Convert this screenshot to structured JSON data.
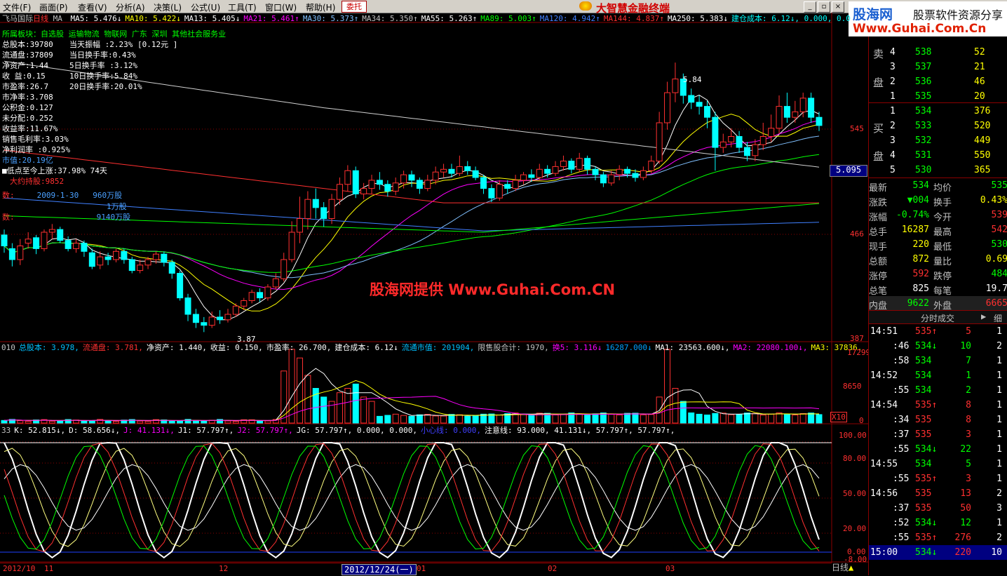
{
  "menu": [
    "文件(F)",
    "画面(P)",
    "查看(V)",
    "分析(A)",
    "决策(L)",
    "公式(U)",
    "工具(T)",
    "窗口(W)",
    "帮助(H)"
  ],
  "entrust_label": "委托",
  "app_title": "大智慧金融终端",
  "banner": {
    "brand": "股海网",
    "slogan": "股票软件资源分享",
    "url": "Www.Guhai.Com.Cn"
  },
  "chart_header": {
    "stock": "飞马国际",
    "period": "日线",
    "ma_label": "MA",
    "ma_items": [
      {
        "text": "MA5: 5.476↓",
        "color": "#ffffff"
      },
      {
        "text": "MA10: 5.422↓",
        "color": "#ffff00"
      },
      {
        "text": "MA13: 5.405↓",
        "color": "#ffffff"
      },
      {
        "text": "MA21: 5.461↑",
        "color": "#ff00ff"
      },
      {
        "text": "MA30: 5.373↑",
        "color": "#80c0ff"
      },
      {
        "text": "MA34: 5.350↑",
        "color": "#c0c0c0"
      },
      {
        "text": "MA55: 5.263↑",
        "color": "#ffffff"
      },
      {
        "text": "MA89: 5.003↑",
        "color": "#00ff00"
      },
      {
        "text": "MA120: 4.942↑",
        "color": "#4080ff"
      },
      {
        "text": "MA144: 4.837↑",
        "color": "#ff3030"
      },
      {
        "text": "MA250: 5.383↓",
        "color": "#ffffff"
      },
      {
        "text": "建仓成本: 6.12↓, 0.000, 0.0",
        "color": "#00ffff"
      }
    ]
  },
  "f10": {
    "industry": "所属板块：自选股 运输物流 物联网 广东 深圳 其他社会服务业",
    "rows_left": [
      "总股本:39780",
      "流通盘:37809",
      "净资产:1.44",
      "收  益:0.15",
      "市盈率:26.7",
      "市净率:3.708",
      "公积金:0.127",
      "未分配:0.252",
      "收益率:11.67%",
      "销售毛利率:3.03%",
      "净利润率 :0.925%"
    ],
    "rows_right": [
      "当天振幅  :2.23% [0.12元 ]",
      "当日换手率:0.43%",
      "5日换手率 :3.12%",
      "10日换手率:5.84%",
      "20日换手率:20.01%"
    ],
    "market_value": "市值:20.19亿",
    "low_gain": "■低点至今上涨:37.98%  74天",
    "holder_label": "大约持股:9852",
    "holder_line1_label": "数:",
    "holder_line1_date": "2009-1-30",
    "holder_line1_value": "960万股",
    "holder_line2_value": "1万股",
    "holder_line3_prefix": "数:",
    "holder_line3_value": "9140万股"
  },
  "price_axis": {
    "labels": [
      "545",
      "5.095",
      "466",
      "387"
    ],
    "current": "5.095"
  },
  "peak_label": "5.84",
  "low_label": "3.87",
  "watermark": "股海网提供 Www.Guhai.Com.CN",
  "vol_header": [
    {
      "text": "010",
      "color": "#c0c0c0"
    },
    {
      "text": "总股本: 3.978,",
      "color": "#00c0ff"
    },
    {
      "text": "流通盘: 3.781,",
      "color": "#ff3030"
    },
    {
      "text": "净资产: 1.440,",
      "color": "#ffffff"
    },
    {
      "text": "收益: 0.150,",
      "color": "#ffffff"
    },
    {
      "text": "市盈率: 26.700,",
      "color": "#ffffff"
    },
    {
      "text": "建仓成本: 6.12↓",
      "color": "#ffffff"
    },
    {
      "text": "流通市值: 201904,",
      "color": "#00c0ff"
    },
    {
      "text": "限售股合计: 1970,",
      "color": "#c0c0c0"
    },
    {
      "text": "换5: 3.116↓",
      "color": "#ff00ff"
    },
    {
      "text": "16287.000↓",
      "color": "#00a0ff"
    },
    {
      "text": "MA1: 23563.600↓,",
      "color": "#ffffff"
    },
    {
      "text": "MA2: 22080.100↓,",
      "color": "#ff00ff"
    },
    {
      "text": "MA3: 37836.",
      "color": "#ffff00"
    }
  ],
  "vol_axis": [
    "17299",
    "8650",
    "0"
  ],
  "vol_unit": "X10",
  "kdj_header": [
    {
      "text": "33",
      "color": "#c0c0c0"
    },
    {
      "text": "K: 52.815↓,",
      "color": "#ffffff"
    },
    {
      "text": "D: 58.656↓,",
      "color": "#ffffff"
    },
    {
      "text": "J: 41.131↓,",
      "color": "#ff00ff"
    },
    {
      "text": "J1: 57.797↑,",
      "color": "#ffffff"
    },
    {
      "text": "J2: 57.797↑,",
      "color": "#ff00ff"
    },
    {
      "text": "JG: 57.797↑, 0.000, 0.000,",
      "color": "#ffffff"
    },
    {
      "text": "小心线: 0.000,",
      "color": "#4040ff"
    },
    {
      "text": "注意线: 93.000, 41.131↓, 57.797↑, 57.797↑,",
      "color": "#ffffff"
    }
  ],
  "kdj_axis": [
    "100.00",
    "80.00",
    "50.00",
    "20.00",
    "0.00",
    "-8.00"
  ],
  "x_axis": {
    "labels": [
      "2012/10",
      "11",
      "12",
      "01",
      "02",
      "03"
    ],
    "cursor_date": "2012/12/24(一)"
  },
  "period_button": "日线",
  "quote": {
    "sell_label": [
      "卖",
      "盘"
    ],
    "buy_label": [
      "买",
      "盘"
    ],
    "sell": [
      {
        "lvl": "4",
        "price": "538",
        "vol": "52"
      },
      {
        "lvl": "3",
        "price": "537",
        "vol": "21"
      },
      {
        "lvl": "2",
        "price": "536",
        "vol": "46"
      },
      {
        "lvl": "1",
        "price": "535",
        "vol": "20"
      }
    ],
    "buy": [
      {
        "lvl": "1",
        "price": "534",
        "vol": "376"
      },
      {
        "lvl": "2",
        "price": "533",
        "vol": "520"
      },
      {
        "lvl": "3",
        "price": "532",
        "vol": "449"
      },
      {
        "lvl": "4",
        "price": "531",
        "vol": "550"
      },
      {
        "lvl": "5",
        "price": "530",
        "vol": "365"
      }
    ],
    "stats": [
      {
        "l1": "最新",
        "v1": "534",
        "c1": "#00ff00",
        "l2": "均价",
        "v2": "535",
        "c2": "#00ff00"
      },
      {
        "l1": "涨跌",
        "v1": "▼004",
        "c1": "#00ff00",
        "l2": "换手",
        "v2": "0.43%",
        "c2": "#ffff00"
      },
      {
        "l1": "涨幅",
        "v1": "-0.74%",
        "c1": "#00ff00",
        "l2": "今开",
        "v2": "539",
        "c2": "#ff3030"
      },
      {
        "l1": "总手",
        "v1": "16287",
        "c1": "#ffff00",
        "l2": "最高",
        "v2": "542",
        "c2": "#ff3030"
      },
      {
        "l1": "现手",
        "v1": "220",
        "c1": "#ffff00",
        "l2": "最低",
        "v2": "530",
        "c2": "#00ff00"
      },
      {
        "l1": "总额",
        "v1": "872",
        "c1": "#ffff00",
        "l2": "量比",
        "v2": "0.69",
        "c2": "#ffff00"
      },
      {
        "l1": "涨停",
        "v1": "592",
        "c1": "#ff3030",
        "l2": "跌停",
        "v2": "484",
        "c2": "#00ff00"
      },
      {
        "l1": "总笔",
        "v1": "825",
        "c1": "#ffffff",
        "l2": "每笔",
        "v2": "19.7",
        "c2": "#ffffff"
      },
      {
        "l1": "内盘",
        "v1": "9622",
        "c1": "#00ff00",
        "l2": "外盘",
        "v2": "6665",
        "c2": "#ff3030"
      }
    ],
    "ticks_title": "分时成交",
    "ticks_detail": "细",
    "ticks": [
      {
        "t": "14:51",
        "p": "535↑",
        "pc": "#ff3030",
        "v": "5",
        "vc": "#ff3030",
        "n": "1"
      },
      {
        "t": ":46",
        "p": "534↓",
        "pc": "#00ff00",
        "v": "10",
        "vc": "#00ff00",
        "n": "2"
      },
      {
        "t": ":58",
        "p": "534",
        "pc": "#00ff00",
        "v": "7",
        "vc": "#00ff00",
        "n": "1"
      },
      {
        "t": "14:52",
        "p": "534",
        "pc": "#00ff00",
        "v": "1",
        "vc": "#00ff00",
        "n": "1"
      },
      {
        "t": ":55",
        "p": "534",
        "pc": "#00ff00",
        "v": "2",
        "vc": "#00ff00",
        "n": "1"
      },
      {
        "t": "14:54",
        "p": "535↑",
        "pc": "#ff3030",
        "v": "8",
        "vc": "#ff3030",
        "n": "1"
      },
      {
        "t": ":34",
        "p": "535",
        "pc": "#ff3030",
        "v": "8",
        "vc": "#ff3030",
        "n": "1"
      },
      {
        "t": ":37",
        "p": "535",
        "pc": "#ff3030",
        "v": "3",
        "vc": "#ff3030",
        "n": "1"
      },
      {
        "t": ":55",
        "p": "534↓",
        "pc": "#00ff00",
        "v": "22",
        "vc": "#00ff00",
        "n": "1"
      },
      {
        "t": "14:55",
        "p": "534",
        "pc": "#00ff00",
        "v": "5",
        "vc": "#00ff00",
        "n": "1"
      },
      {
        "t": ":55",
        "p": "535↑",
        "pc": "#ff3030",
        "v": "3",
        "vc": "#ff3030",
        "n": "1"
      },
      {
        "t": "14:56",
        "p": "535",
        "pc": "#ff3030",
        "v": "13",
        "vc": "#ff3030",
        "n": "2"
      },
      {
        "t": ":37",
        "p": "535",
        "pc": "#ff3030",
        "v": "50",
        "vc": "#ff3030",
        "n": "3"
      },
      {
        "t": ":52",
        "p": "534↓",
        "pc": "#00ff00",
        "v": "12",
        "vc": "#00ff00",
        "n": "1"
      },
      {
        "t": ":55",
        "p": "535↑",
        "pc": "#ff3030",
        "v": "276",
        "vc": "#ff3030",
        "n": "2"
      },
      {
        "t": "15:00",
        "p": "534↓",
        "pc": "#00ff00",
        "v": "220",
        "vc": "#ff3030",
        "n": "10"
      }
    ]
  },
  "candles": [
    [
      4.58,
      4.5,
      4.62,
      4.45
    ],
    [
      4.48,
      4.4,
      4.52,
      4.35
    ],
    [
      4.4,
      4.5,
      4.55,
      4.36
    ],
    [
      4.52,
      4.55,
      4.6,
      4.48
    ],
    [
      4.56,
      4.48,
      4.58,
      4.44
    ],
    [
      4.48,
      4.6,
      4.62,
      4.46
    ],
    [
      4.6,
      4.62,
      4.66,
      4.55
    ],
    [
      4.62,
      4.54,
      4.64,
      4.52
    ],
    [
      4.54,
      4.48,
      4.57,
      4.46
    ],
    [
      4.48,
      4.52,
      4.55,
      4.45
    ],
    [
      4.52,
      4.46,
      4.54,
      4.42
    ],
    [
      4.45,
      4.35,
      4.48,
      4.33
    ],
    [
      4.36,
      4.42,
      4.46,
      4.33
    ],
    [
      4.42,
      4.4,
      4.45,
      4.36
    ],
    [
      4.4,
      4.46,
      4.48,
      4.38
    ],
    [
      4.46,
      4.4,
      4.48,
      4.37
    ],
    [
      4.4,
      4.32,
      4.42,
      4.3
    ],
    [
      4.32,
      4.36,
      4.4,
      4.3
    ],
    [
      4.36,
      4.4,
      4.42,
      4.33
    ],
    [
      4.4,
      4.44,
      4.46,
      4.37
    ],
    [
      4.44,
      4.38,
      4.46,
      4.35
    ],
    [
      4.38,
      4.3,
      4.4,
      4.26
    ],
    [
      4.3,
      4.12,
      4.32,
      4.1
    ],
    [
      4.12,
      4.0,
      4.15,
      3.95
    ],
    [
      4.0,
      3.94,
      4.04,
      3.9
    ],
    [
      3.94,
      3.92,
      3.98,
      3.87
    ],
    [
      3.92,
      3.98,
      4.02,
      3.9
    ],
    [
      3.98,
      3.96,
      4.03,
      3.93
    ],
    [
      3.96,
      4.0,
      4.04,
      3.94
    ],
    [
      4.0,
      4.06,
      4.08,
      3.98
    ],
    [
      4.06,
      4.1,
      4.12,
      4.03
    ],
    [
      4.1,
      4.16,
      4.18,
      4.08
    ],
    [
      4.16,
      4.12,
      4.19,
      4.09
    ],
    [
      4.12,
      4.2,
      4.22,
      4.1
    ],
    [
      4.2,
      4.26,
      4.3,
      4.18
    ],
    [
      4.26,
      4.4,
      4.45,
      4.24
    ],
    [
      4.4,
      4.6,
      4.68,
      4.38
    ],
    [
      4.6,
      4.7,
      4.86,
      4.52
    ],
    [
      4.7,
      4.84,
      4.9,
      4.62
    ],
    [
      4.84,
      4.78,
      4.92,
      4.7
    ],
    [
      4.78,
      4.7,
      4.82,
      4.64
    ],
    [
      4.7,
      4.84,
      4.88,
      4.66
    ],
    [
      4.84,
      4.95,
      5.0,
      4.8
    ],
    [
      4.95,
      5.05,
      5.09,
      4.9
    ],
    [
      5.05,
      4.88,
      5.08,
      4.85
    ],
    [
      4.88,
      4.92,
      4.96,
      4.84
    ],
    [
      4.92,
      4.98,
      5.02,
      4.88
    ],
    [
      4.98,
      4.95,
      5.04,
      4.91
    ],
    [
      4.95,
      4.9,
      4.98,
      4.86
    ],
    [
      4.9,
      4.96,
      5.0,
      4.87
    ],
    [
      4.96,
      5.02,
      5.05,
      4.92
    ],
    [
      5.02,
      4.98,
      5.05,
      4.93
    ],
    [
      4.98,
      4.92,
      5.0,
      4.88
    ],
    [
      4.92,
      4.98,
      5.02,
      4.9
    ],
    [
      4.98,
      5.04,
      5.08,
      4.95
    ],
    [
      5.04,
      5.06,
      5.1,
      5.0
    ],
    [
      5.06,
      5.03,
      5.1,
      5.0
    ],
    [
      5.03,
      5.08,
      5.16,
      5.01
    ],
    [
      5.08,
      5.05,
      5.12,
      5.02
    ],
    [
      5.05,
      5.0,
      5.08,
      4.98
    ],
    [
      5.0,
      4.92,
      5.02,
      4.88
    ],
    [
      4.92,
      4.85,
      4.95,
      4.82
    ],
    [
      4.85,
      4.95,
      4.98,
      4.83
    ],
    [
      4.95,
      4.92,
      4.98,
      4.88
    ],
    [
      4.92,
      4.98,
      5.02,
      4.9
    ],
    [
      4.98,
      5.02,
      5.04,
      4.95
    ],
    [
      5.02,
      5.0,
      5.06,
      4.97
    ],
    [
      5.0,
      5.06,
      5.1,
      4.98
    ],
    [
      5.06,
      5.03,
      5.09,
      5.0
    ],
    [
      5.03,
      5.08,
      5.12,
      5.01
    ],
    [
      5.08,
      5.12,
      5.16,
      5.05
    ],
    [
      5.12,
      5.06,
      5.14,
      5.03
    ],
    [
      5.06,
      5.14,
      5.18,
      5.04
    ],
    [
      5.14,
      5.06,
      5.16,
      5.02
    ],
    [
      5.06,
      5.02,
      5.08,
      4.98
    ],
    [
      5.02,
      4.96,
      5.04,
      4.93
    ],
    [
      4.96,
      5.02,
      5.05,
      4.94
    ],
    [
      5.02,
      5.06,
      5.09,
      4.98
    ],
    [
      5.06,
      5.03,
      5.08,
      5.0
    ],
    [
      5.03,
      5.0,
      5.06,
      4.97
    ],
    [
      5.0,
      5.05,
      5.08,
      4.98
    ],
    [
      5.05,
      5.12,
      5.16,
      5.03
    ],
    [
      5.12,
      5.4,
      5.48,
      5.1
    ],
    [
      5.4,
      5.62,
      5.7,
      5.35
    ],
    [
      5.62,
      5.72,
      5.84,
      5.55
    ],
    [
      5.72,
      5.6,
      5.76,
      5.54
    ],
    [
      5.6,
      5.55,
      5.65,
      5.5
    ],
    [
      5.55,
      5.52,
      5.6,
      5.46
    ],
    [
      5.52,
      5.44,
      5.56,
      5.36
    ],
    [
      5.44,
      5.22,
      5.48,
      5.05
    ],
    [
      5.22,
      5.26,
      5.32,
      5.18
    ],
    [
      5.26,
      5.3,
      5.36,
      5.22
    ],
    [
      5.3,
      5.22,
      5.34,
      5.18
    ],
    [
      5.22,
      5.16,
      5.26,
      5.12
    ],
    [
      5.16,
      5.24,
      5.28,
      5.12
    ],
    [
      5.24,
      5.3,
      5.4,
      5.2
    ],
    [
      5.3,
      5.36,
      5.46,
      5.26
    ],
    [
      5.36,
      5.52,
      5.6,
      5.32
    ],
    [
      5.52,
      5.44,
      5.62,
      5.4
    ],
    [
      5.44,
      5.48,
      5.56,
      5.4
    ],
    [
      5.48,
      5.58,
      5.62,
      5.44
    ],
    [
      5.58,
      5.44,
      5.62,
      5.4
    ],
    [
      5.44,
      5.38,
      5.48,
      5.34
    ]
  ]
}
